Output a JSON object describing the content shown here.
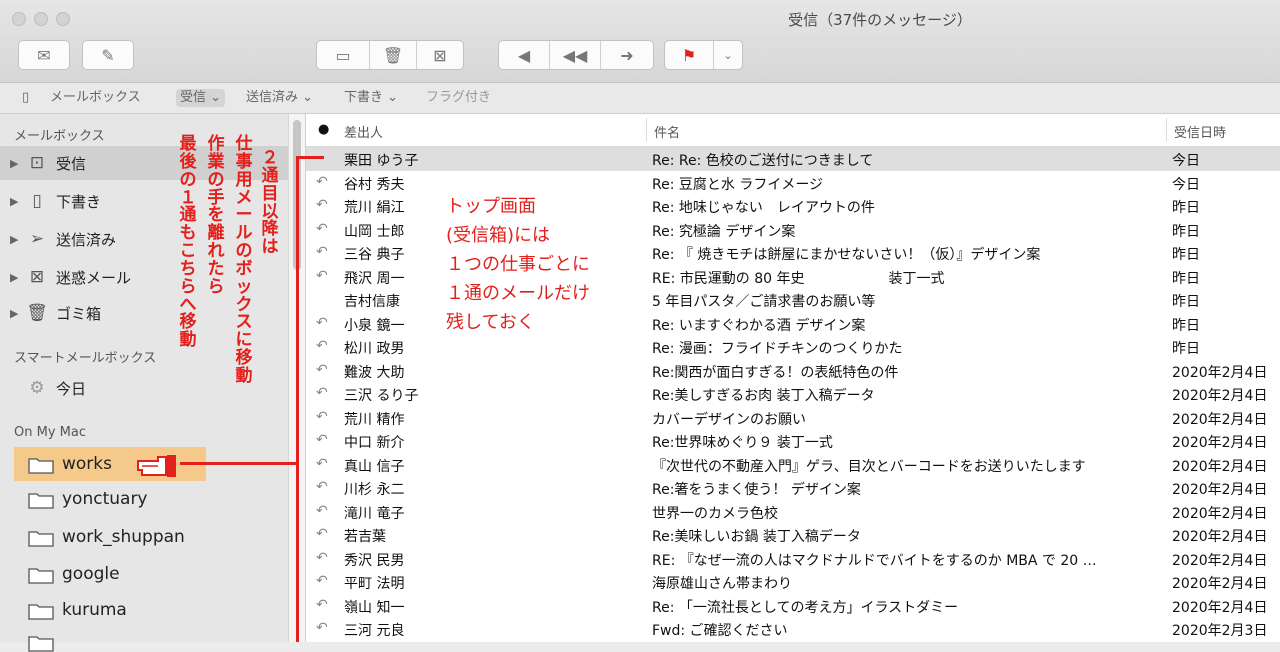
{
  "window": {
    "title": "受信（37件のメッセージ）"
  },
  "toolbar": {
    "buttons": [
      "envelope-icon",
      "compose-icon",
      "archive-icon",
      "trash-icon",
      "junk-icon",
      "reply-icon",
      "reply-all-icon",
      "forward-icon",
      "flag-icon",
      "chevron-down-icon"
    ]
  },
  "favorites": {
    "mailbox_label": "メールボックス",
    "inbox_label": "受信 ⌄",
    "sent_label": "送信済み ⌄",
    "drafts_label": "下書き ⌄",
    "flagged_label": "フラグ付き"
  },
  "sidebar": {
    "mailboxes_header": "メールボックス",
    "mailboxes": [
      {
        "label": "受信",
        "icon": "inbox-icon"
      },
      {
        "label": "下書き",
        "icon": "drafts-icon"
      },
      {
        "label": "送信済み",
        "icon": "sent-icon"
      },
      {
        "label": "迷惑メール",
        "icon": "junk-icon"
      },
      {
        "label": "ゴミ箱",
        "icon": "trash-icon"
      }
    ],
    "smart_header": "スマートメールボックス",
    "smart": [
      {
        "label": "今日",
        "icon": "gear-icon"
      }
    ],
    "onmymac_header": "On My Mac",
    "folders": [
      "works",
      "yonctuary",
      "work_shuppan",
      "google",
      "kuruma",
      ""
    ]
  },
  "list": {
    "col_sender": "差出人",
    "col_subject": "件名",
    "col_date": "受信日時",
    "rows": [
      {
        "sender": "栗田 ゆう子",
        "subject": "Re: Re: 色校のご送付につきまして",
        "date": "今日",
        "replied": false
      },
      {
        "sender": "谷村 秀夫",
        "subject": "Re: 豆腐と水 ラフイメージ",
        "date": "今日",
        "replied": true
      },
      {
        "sender": "荒川 絹江",
        "subject": "Re: 地味じゃない　レイアウトの件",
        "date": "昨日",
        "replied": true
      },
      {
        "sender": "山岡 士郎",
        "subject": "Re: 究極論 デザイン案",
        "date": "昨日",
        "replied": true
      },
      {
        "sender": "三谷 典子",
        "subject": "Re: 『 焼きモチは餅屋にまかせないさい！（仮）』デザイン案",
        "date": "昨日",
        "replied": true
      },
      {
        "sender": "飛沢 周一",
        "subject": "RE: 市民運動の 80 年史　　　　　　装丁一式",
        "date": "昨日",
        "replied": true
      },
      {
        "sender": "吉村信康",
        "subject": "5 年目パスタ／ご請求書のお願い等",
        "date": "昨日",
        "replied": false
      },
      {
        "sender": "小泉 鏡一",
        "subject": "Re: いますぐわかる酒 デザイン案",
        "date": "昨日",
        "replied": true
      },
      {
        "sender": "松川 政男",
        "subject": "Re: 漫画：フライドチキンのつくりかた",
        "date": "昨日",
        "replied": true
      },
      {
        "sender": "難波 大助",
        "subject": "Re:関西が面白すぎる！の表紙特色の件",
        "date": "2020年2月4日",
        "replied": true
      },
      {
        "sender": "三沢 るり子",
        "subject": "Re:美しすぎるお肉 装丁入稿データ",
        "date": "2020年2月4日",
        "replied": true
      },
      {
        "sender": "荒川 精作",
        "subject": "カバーデザインのお願い",
        "date": "2020年2月4日",
        "replied": true
      },
      {
        "sender": "中口 新介",
        "subject": "Re:世界味めぐり９ 装丁一式",
        "date": "2020年2月4日",
        "replied": true
      },
      {
        "sender": "真山 信子",
        "subject": "『次世代の不動産入門』ゲラ、目次とバーコードをお送りいたします",
        "date": "2020年2月4日",
        "replied": true
      },
      {
        "sender": "川杉 永二",
        "subject": "Re:箸をうまく使う！ デザイン案",
        "date": "2020年2月4日",
        "replied": true
      },
      {
        "sender": "滝川 竜子",
        "subject": "世界一のカメラ色校",
        "date": "2020年2月4日",
        "replied": true
      },
      {
        "sender": "若吉葉",
        "subject": "Re:美味しいお鍋 装丁入稿データ",
        "date": "2020年2月4日",
        "replied": true
      },
      {
        "sender": "秀沢 民男",
        "subject": "RE: 『なぜ一流の人はマクドナルドでバイトをするのか MBA で 20 …",
        "date": "2020年2月4日",
        "replied": true
      },
      {
        "sender": "平町 法明",
        "subject": "海原雄山さん帯まわり",
        "date": "2020年2月4日",
        "replied": true
      },
      {
        "sender": "嶺山 知一",
        "subject": "Re: 「一流社長としての考え方」イラストダミー",
        "date": "2020年2月4日",
        "replied": true
      },
      {
        "sender": "三河 元良",
        "subject": "Fwd: ご確認ください",
        "date": "2020年2月3日",
        "replied": true
      }
    ]
  },
  "annotations": {
    "col1": "２通目以降は",
    "col2": "仕事用メールのボックスに移動",
    "col3": "作業の手を離れたら",
    "col4": "最後の１通もこちらへ移動",
    "big_lines": [
      "トップ画面",
      "(受信箱)には",
      "１つの仕事ごとに",
      "１通のメールだけ",
      "残しておく"
    ],
    "accent_color": "#e3201b"
  }
}
